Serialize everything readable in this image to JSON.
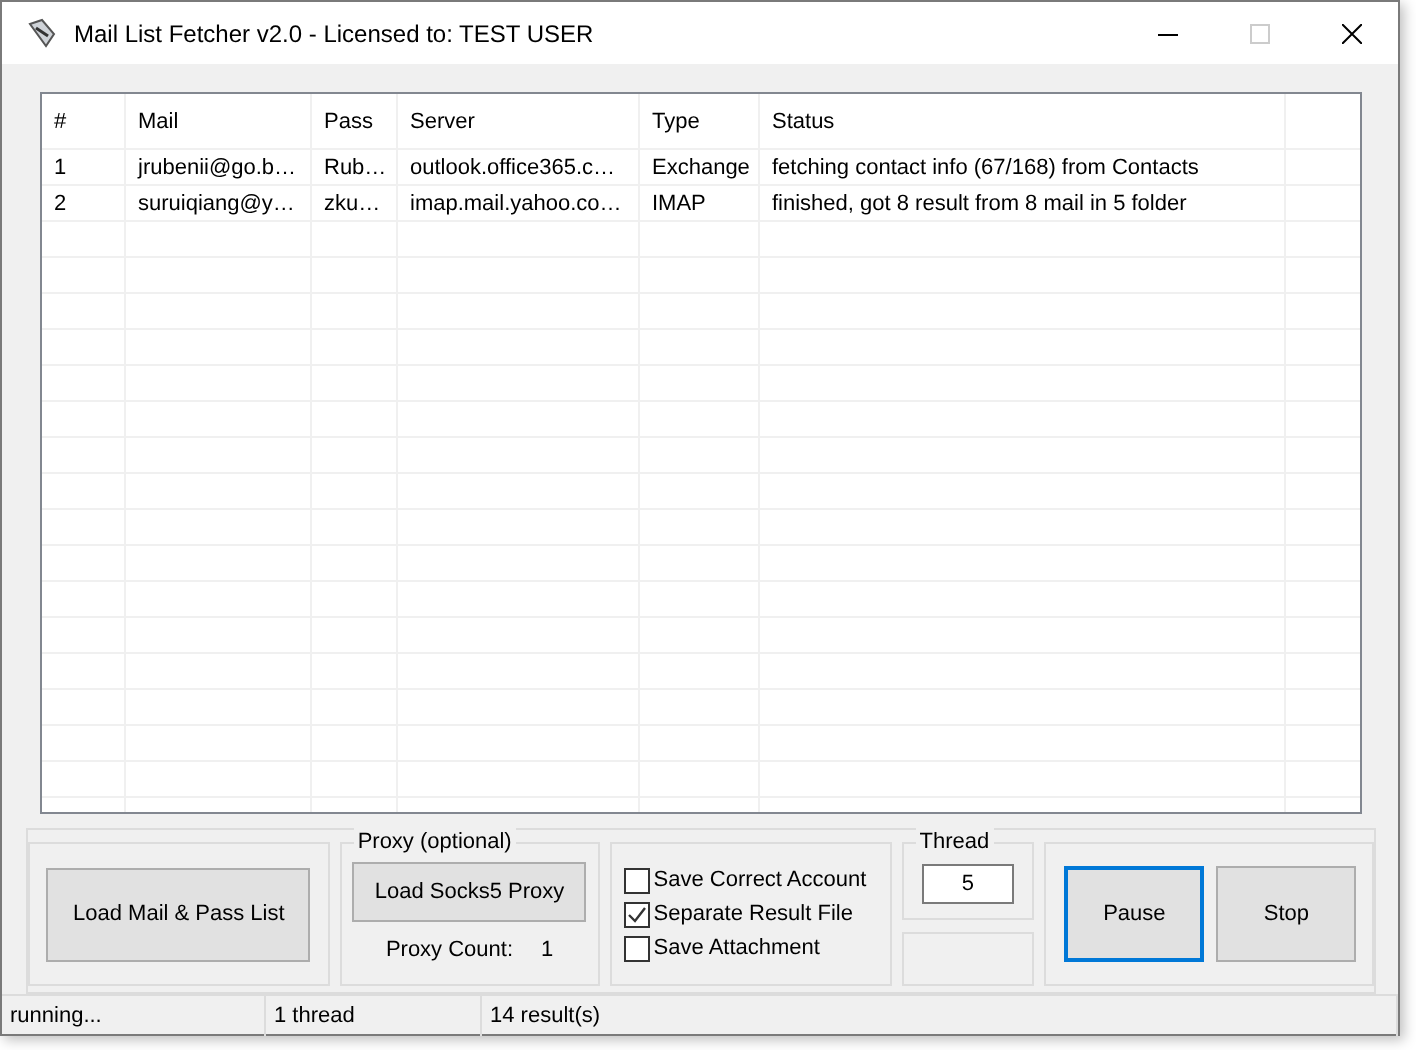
{
  "window": {
    "title": "Mail List Fetcher v2.0 - Licensed to: TEST USER"
  },
  "table": {
    "columns": [
      "#",
      "Mail",
      "Pass",
      "Server",
      "Type",
      "Status"
    ],
    "rows": [
      {
        "cells": [
          "1",
          "jrubenii@go.b…",
          "Rub…",
          "outlook.office365.c…",
          "Exchange",
          "fetching contact info (67/168) from Contacts"
        ]
      },
      {
        "cells": [
          "2",
          "suruiqiang@y…",
          "zku…",
          "imap.mail.yahoo.co…",
          "IMAP",
          "finished, got 8 result from 8 mail in 5 folder"
        ]
      }
    ]
  },
  "load_button": {
    "label": "Load Mail & Pass List"
  },
  "proxy": {
    "title": "Proxy (optional)",
    "button": "Load Socks5 Proxy",
    "count_label": "Proxy Count:",
    "count": "1"
  },
  "options": [
    {
      "label": "Save Correct Account",
      "checked": false
    },
    {
      "label": "Separate Result File",
      "checked": true
    },
    {
      "label": "Save Attachment",
      "checked": false
    }
  ],
  "thread": {
    "title": "Thread",
    "value": "5"
  },
  "buttons": [
    {
      "label": "Pause",
      "focused": true
    },
    {
      "label": "Stop",
      "focused": false
    }
  ],
  "status_bar": [
    "running...",
    "1 thread",
    "14 result(s)"
  ]
}
